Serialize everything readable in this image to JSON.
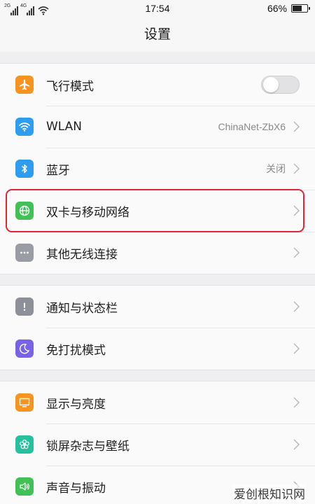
{
  "status_bar": {
    "sim1_network": "2G",
    "sim2_network": "4G",
    "time": "17:54",
    "battery_percent": "66%",
    "battery_level": 0.66
  },
  "header": {
    "title": "设置"
  },
  "colors": {
    "airplane": "#f7931e",
    "wlan": "#2e9df0",
    "bluetooth": "#2e9df0",
    "mobile_network": "#3fc156",
    "other_wireless": "#9a9ca3",
    "notifications": "#8e9098",
    "dnd": "#7a62e6",
    "display": "#f7931e",
    "lockscreen": "#25c19f",
    "sound": "#3fc156",
    "highlight": "#e0253a"
  },
  "groups": [
    {
      "items": [
        {
          "label": "飞行模式",
          "icon": "airplane-icon",
          "type": "toggle",
          "toggle_on": false
        },
        {
          "label": "WLAN",
          "icon": "wifi-icon",
          "value": "ChinaNet-ZbX6"
        },
        {
          "label": "蓝牙",
          "icon": "bluetooth-icon",
          "value": "关闭"
        },
        {
          "label": "双卡与移动网络",
          "icon": "globe-icon",
          "highlighted": true
        },
        {
          "label": "其他无线连接",
          "icon": "more-icon"
        }
      ]
    },
    {
      "items": [
        {
          "label": "通知与状态栏",
          "icon": "exclamation-icon"
        },
        {
          "label": "免打扰模式",
          "icon": "moon-icon"
        }
      ]
    },
    {
      "items": [
        {
          "label": "显示与亮度",
          "icon": "monitor-icon"
        },
        {
          "label": "锁屏杂志与壁纸",
          "icon": "flower-icon"
        },
        {
          "label": "声音与振动",
          "icon": "speaker-icon"
        }
      ]
    }
  ],
  "watermark": "爱创根知识网"
}
